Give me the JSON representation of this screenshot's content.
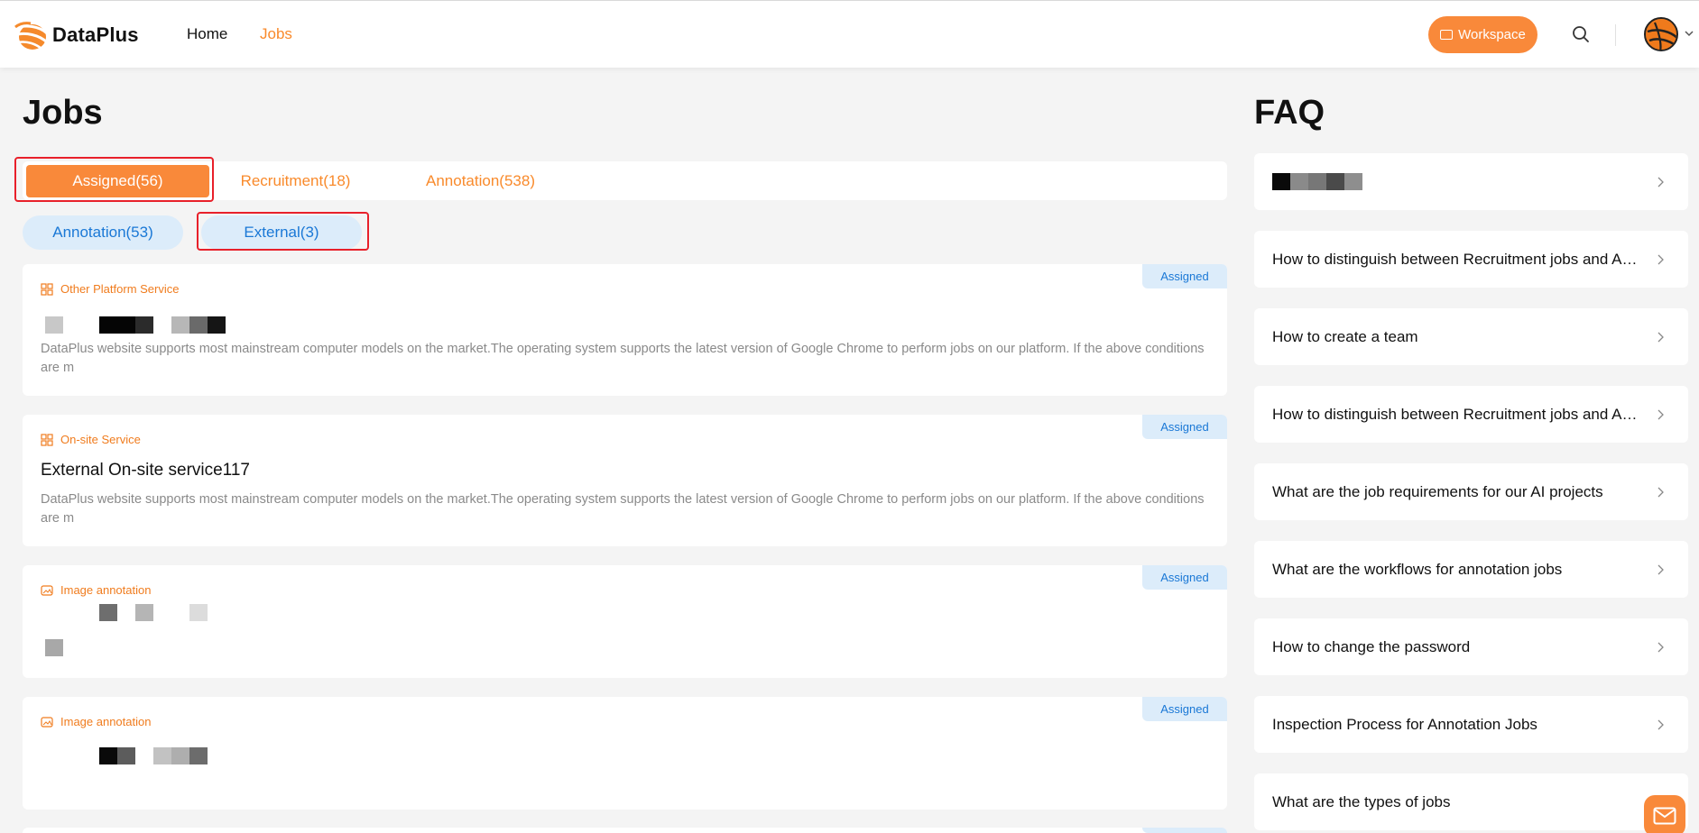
{
  "header": {
    "brand": "DataPlus",
    "nav": [
      {
        "label": "Home",
        "active": false
      },
      {
        "label": "Jobs",
        "active": true
      }
    ],
    "workspace_label": "Workspace",
    "icons": [
      "logo-icon",
      "search-icon",
      "avatar",
      "chevron-down-icon"
    ]
  },
  "jobs": {
    "title": "Jobs",
    "tabs": [
      {
        "label": "Assigned(56)",
        "active": true
      },
      {
        "label": "Recruitment(18)",
        "active": false
      },
      {
        "label": "Annotation(538)",
        "active": false
      }
    ],
    "subtabs": [
      {
        "label": "Annotation(53)",
        "active": false
      },
      {
        "label": "External(3)",
        "active": true
      }
    ],
    "cards": [
      {
        "category": "Other Platform Service",
        "badge": "Assigned",
        "title": "",
        "description": "DataPlus website supports most mainstream computer models on the market.The operating system supports the latest version of Google Chrome to perform jobs on our platform. If the above conditions are m"
      },
      {
        "category": "On-site Service",
        "badge": "Assigned",
        "title": "External On-site service117",
        "description": "DataPlus website supports most mainstream computer models on the market.The operating system supports the latest version of Google Chrome to perform jobs on our platform. If the above conditions are m"
      },
      {
        "category": "Image annotation",
        "badge": "Assigned",
        "title": "",
        "description": ""
      },
      {
        "category": "Image annotation",
        "badge": "Assigned",
        "title": "",
        "description": ""
      }
    ]
  },
  "faq": {
    "title": "FAQ",
    "items": [
      "",
      "How to distinguish between Recruitment jobs and Annotation jobs",
      "How to create a team",
      "How to distinguish between Recruitment jobs and Annotation jobs",
      "What are the job requirements for our AI projects",
      "What are the workflows for annotation jobs",
      "How to change the password",
      "Inspection Process for Annotation Jobs",
      "What are the types of jobs"
    ]
  },
  "colors": {
    "accent": "#f9893a",
    "accent_text": "#f98a2b",
    "blue": "#1a78d6",
    "blue_bg": "#dcecfa",
    "highlight": "#e8202a"
  }
}
